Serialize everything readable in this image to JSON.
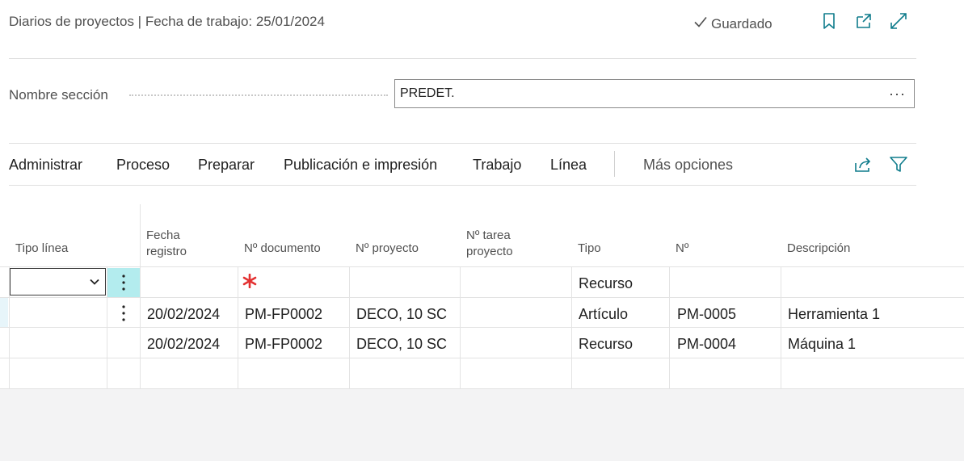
{
  "header": {
    "title": "Diarios de proyectos | Fecha de trabajo: 25/01/2024",
    "saved_status": "Guardado",
    "icons": [
      "checkmark-icon",
      "bookmark-icon",
      "open-new-window-icon",
      "expand-icon"
    ]
  },
  "section": {
    "label": "Nombre sección",
    "value": "PREDET.",
    "lookup_glyph": "···"
  },
  "actions": {
    "items": [
      "Administrar",
      "Proceso",
      "Preparar",
      "Publicación e impresión",
      "Trabajo",
      "Línea"
    ],
    "more": "Más opciones",
    "icons": [
      "share-icon",
      "filter-icon"
    ]
  },
  "grid": {
    "columns": [
      "Tipo línea",
      "Fecha registro",
      "Nº documento",
      "Nº proyecto",
      "Nº tarea proyecto",
      "Tipo",
      "Nº",
      "Descripción"
    ],
    "rows": [
      {
        "tipo_linea": "",
        "fecha": "",
        "documento": "",
        "proyecto": "",
        "tarea": "",
        "tipo": "Recurso",
        "no": "",
        "descripcion": ""
      },
      {
        "tipo_linea": "",
        "fecha": "20/02/2024",
        "documento": "PM-FP0002",
        "proyecto": "DECO, 10 SC",
        "tarea": "",
        "tipo": "Artículo",
        "no": "PM-0005",
        "descripcion": "Herramienta 1"
      },
      {
        "tipo_linea": "",
        "fecha": "20/02/2024",
        "documento": "PM-FP0002",
        "proyecto": "DECO, 10 SC",
        "tarea": "",
        "tipo": "Recurso",
        "no": "PM-0004",
        "descripcion": "Máquina 1"
      }
    ]
  },
  "colors": {
    "active_row_menu": "#b3ecee",
    "accent_icon": "#0f7c8c",
    "required": "#e33232"
  }
}
